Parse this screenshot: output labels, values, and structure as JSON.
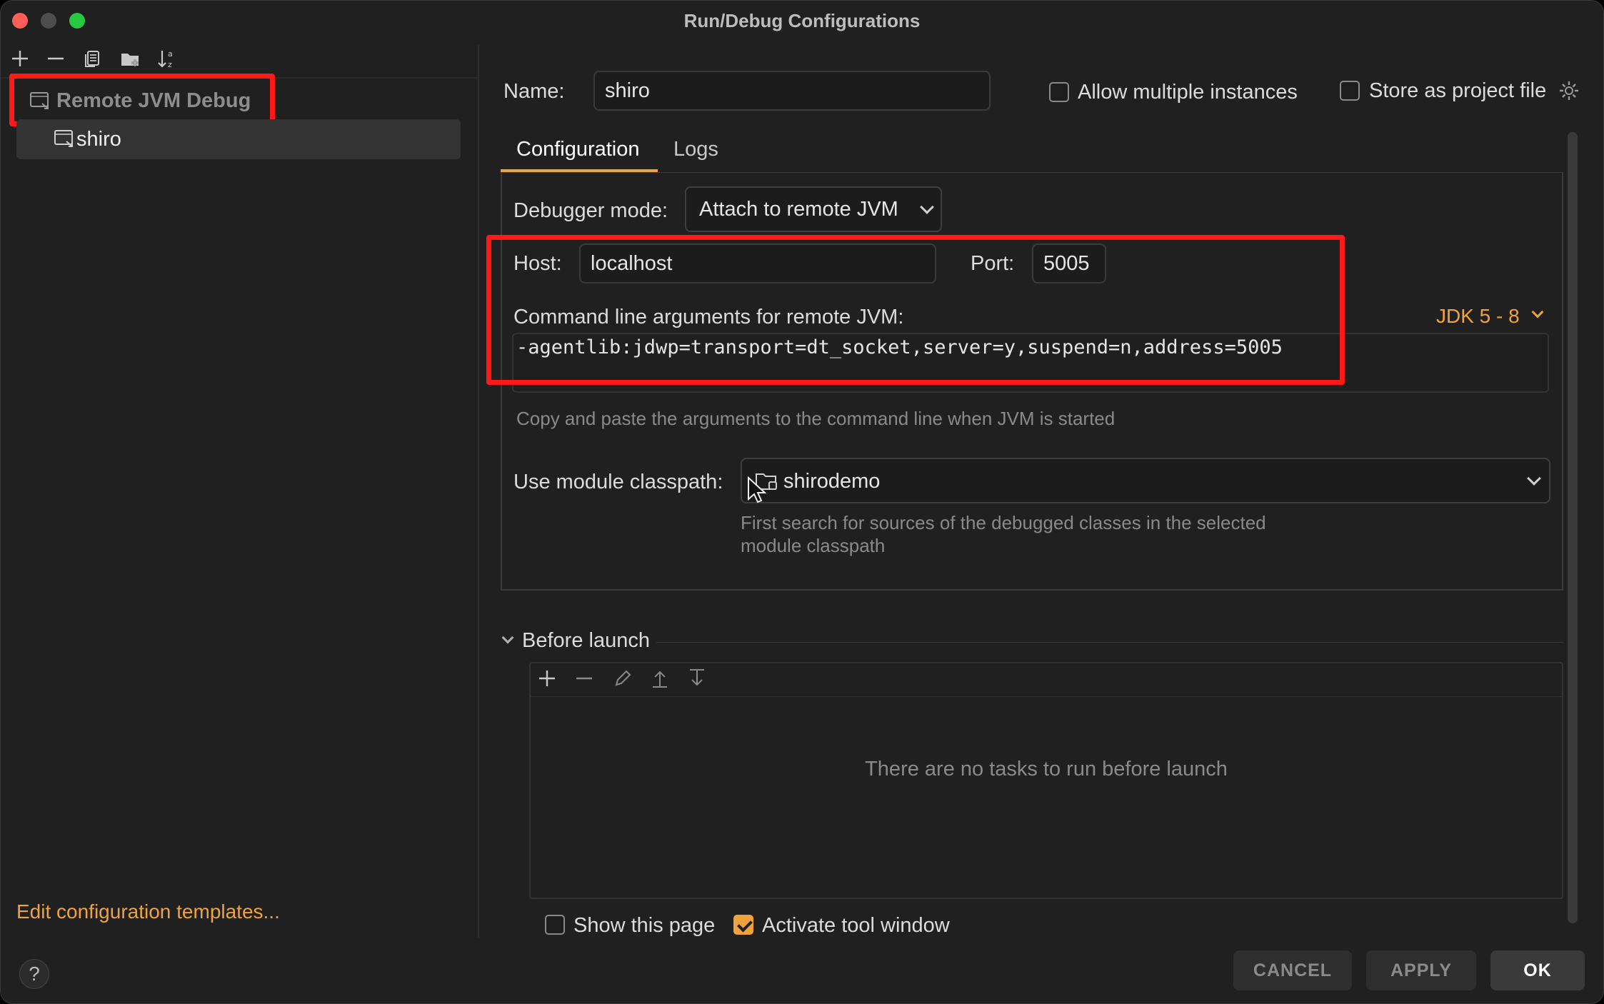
{
  "window": {
    "title": "Run/Debug Configurations"
  },
  "sidebar": {
    "toolbar": [
      "add-icon",
      "remove-icon",
      "copy-icon",
      "new-folder-icon",
      "sort-icon"
    ],
    "group": {
      "label": "Remote JVM Debug"
    },
    "item": {
      "label": "shiro"
    },
    "templates_link": "Edit configuration templates...",
    "help": "?"
  },
  "header": {
    "name_label": "Name:",
    "name_value": "shiro",
    "allow_multiple_label": "Allow multiple instances",
    "allow_multiple_checked": false,
    "store_project_label": "Store as project file",
    "store_project_checked": false
  },
  "tabs": [
    {
      "label": "Configuration",
      "active": true
    },
    {
      "label": "Logs",
      "active": false
    }
  ],
  "config": {
    "debugger_mode_label": "Debugger mode:",
    "debugger_mode_value": "Attach to remote JVM",
    "host_label": "Host:",
    "host_value": "localhost",
    "port_label": "Port:",
    "port_value": "5005",
    "cmd_label": "Command line arguments for remote JVM:",
    "jdk_value": "JDK 5 - 8",
    "cmd_args": "-agentlib:jdwp=transport=dt_socket,server=y,suspend=n,address=5005",
    "cmd_hint": "Copy and paste the arguments to the command line when JVM is started",
    "module_label": "Use module classpath:",
    "module_value": "shirodemo",
    "module_hint_1": "First search for sources of the debugged classes in the selected",
    "module_hint_2": "module classpath"
  },
  "before_launch": {
    "title": "Before launch",
    "toolbar": [
      "add-icon",
      "remove-icon",
      "edit-icon",
      "move-up-icon",
      "move-down-icon"
    ],
    "empty_message": "There are no tasks to run before launch",
    "show_page_label": "Show this page",
    "show_page_checked": false,
    "activate_tool_label": "Activate tool window",
    "activate_tool_checked": true
  },
  "buttons": {
    "cancel": "CANCEL",
    "apply": "APPLY",
    "ok": "OK"
  },
  "colors": {
    "accent": "#f0a33c",
    "highlight": "#ff1a1a",
    "background": "#202020"
  }
}
